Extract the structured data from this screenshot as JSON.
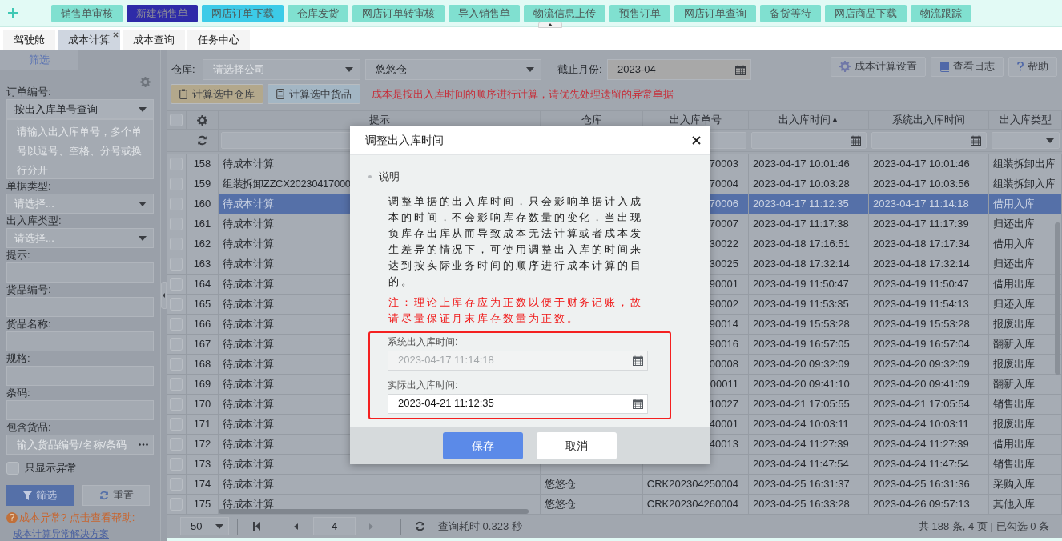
{
  "toolbar": {
    "buttons": [
      {
        "label": "销售单审核",
        "color": "#80e0d0"
      },
      {
        "label": "新建销售单",
        "color": "#2e2ba8"
      },
      {
        "label": "网店订单下载",
        "color": "#3ccbe8"
      },
      {
        "label": "仓库发货",
        "color": "#80e0d0"
      },
      {
        "label": "网店订单转审核",
        "color": "#80e0d0"
      },
      {
        "label": "导入销售单",
        "color": "#80e0d0"
      },
      {
        "label": "物流信息上传",
        "color": "#80e0d0"
      },
      {
        "label": "预售订单",
        "color": "#80e0d0"
      },
      {
        "label": "网店订单查询",
        "color": "#80e0d0"
      },
      {
        "label": "备货等待",
        "color": "#80e0d0"
      },
      {
        "label": "网店商品下载",
        "color": "#80e0d0"
      },
      {
        "label": "物流跟踪",
        "color": "#80e0d0"
      }
    ]
  },
  "tabs": [
    {
      "label": "驾驶舱",
      "selected": false,
      "closable": false
    },
    {
      "label": "成本计算",
      "selected": true,
      "closable": true
    },
    {
      "label": "成本查询",
      "selected": false,
      "closable": false
    },
    {
      "label": "任务中心",
      "selected": false,
      "closable": false
    }
  ],
  "sidebar": {
    "tab": "筛选",
    "fields": [
      {
        "label": "订单编号:",
        "kind": "select",
        "value": "按出入库单号查询"
      },
      {
        "kind": "textarea",
        "placeholder": "请输入出入库单号，多个单号以逗号、空格、分号或换行分开"
      },
      {
        "label": "单据类型:",
        "kind": "select",
        "placeholder": "请选择..."
      },
      {
        "label": "出入库类型:",
        "kind": "select",
        "placeholder": "请选择..."
      },
      {
        "label": "提示:",
        "kind": "input"
      },
      {
        "label": "货品编号:",
        "kind": "input"
      },
      {
        "label": "货品名称:",
        "kind": "input"
      },
      {
        "label": "规格:",
        "kind": "input"
      },
      {
        "label": "条码:",
        "kind": "input"
      },
      {
        "label": "包含货品:",
        "kind": "picker",
        "placeholder": "输入货品编号/名称/条码"
      }
    ],
    "only_abnormal": {
      "label": "只显示异常",
      "checked": false
    },
    "buttons": [
      {
        "label": "筛选",
        "kind": "primary"
      },
      {
        "label": "重置",
        "kind": "default"
      }
    ],
    "help_text": "成本异常? 点击查看帮助:",
    "help_link": "成本计算异常解决方案"
  },
  "filters": {
    "warehouse_label": "仓库:",
    "company_placeholder": "请选择公司",
    "warehouse_value": "悠悠仓",
    "month_label": "截止月份:",
    "month_value": "2023-04",
    "tools": [
      "成本计算设置",
      "查看日志",
      "帮助"
    ],
    "actions": [
      {
        "label": "计算选中仓库",
        "color": "#b3a88c"
      },
      {
        "label": "计算选中货品",
        "color": "#a3b6c4"
      }
    ],
    "notice": "成本是按出入库时间的顺序进行计算，请优先处理遗留的异常单据"
  },
  "table": {
    "select_all": {
      "checked": false
    },
    "columns": [
      {
        "label": "提示"
      },
      {
        "label": "仓库"
      },
      {
        "label": "出入库单号"
      },
      {
        "label": "出入库时间",
        "sort_mark": "▲"
      },
      {
        "label": "系统出入库时间"
      },
      {
        "label": "出入库类型"
      }
    ],
    "rows": [
      {
        "index": "158",
        "checked": false,
        "selected": false,
        "hint": "待成本计算",
        "doc_no": "70003",
        "time": "2023-04-17 10:01:46",
        "sys_time": "2023-04-17 10:01:46",
        "type": "组装拆卸出库"
      },
      {
        "index": "159",
        "checked": false,
        "selected": false,
        "hint": "组装拆卸ZZCX20230417000",
        "doc_no": "70004",
        "time": "2023-04-17 10:03:28",
        "sys_time": "2023-04-17 10:03:56",
        "type": "组装拆卸入库"
      },
      {
        "index": "160",
        "checked": false,
        "selected": true,
        "hint": "待成本计算",
        "doc_no": "70006",
        "time": "2023-04-17 11:12:35",
        "sys_time": "2023-04-17 11:14:18",
        "type": "借用入库"
      },
      {
        "index": "161",
        "checked": false,
        "selected": false,
        "hint": "待成本计算",
        "doc_no": "70007",
        "time": "2023-04-17 11:17:38",
        "sys_time": "2023-04-17 11:17:39",
        "type": "归还出库"
      },
      {
        "index": "162",
        "checked": false,
        "selected": false,
        "hint": "待成本计算",
        "doc_no": "30022",
        "time": "2023-04-18 17:16:51",
        "sys_time": "2023-04-18 17:17:34",
        "type": "借用入库"
      },
      {
        "index": "163",
        "checked": false,
        "selected": false,
        "hint": "待成本计算",
        "doc_no": "30025",
        "time": "2023-04-18 17:32:14",
        "sys_time": "2023-04-18 17:32:14",
        "type": "归还出库"
      },
      {
        "index": "164",
        "checked": false,
        "selected": false,
        "hint": "待成本计算",
        "doc_no": "90001",
        "time": "2023-04-19 11:50:47",
        "sys_time": "2023-04-19 11:50:47",
        "type": "借用出库"
      },
      {
        "index": "165",
        "checked": false,
        "selected": false,
        "hint": "待成本计算",
        "doc_no": "90002",
        "time": "2023-04-19 11:53:35",
        "sys_time": "2023-04-19 11:54:13",
        "type": "归还入库"
      },
      {
        "index": "166",
        "checked": false,
        "selected": false,
        "hint": "待成本计算",
        "doc_no": "90014",
        "time": "2023-04-19 15:53:28",
        "sys_time": "2023-04-19 15:53:28",
        "type": "报废出库"
      },
      {
        "index": "167",
        "checked": false,
        "selected": false,
        "hint": "待成本计算",
        "doc_no": "90016",
        "time": "2023-04-19 16:57:05",
        "sys_time": "2023-04-19 16:57:04",
        "type": "翻新入库"
      },
      {
        "index": "168",
        "checked": false,
        "selected": false,
        "hint": "待成本计算",
        "doc_no": "00008",
        "time": "2023-04-20 09:32:09",
        "sys_time": "2023-04-20 09:32:09",
        "type": "报废出库"
      },
      {
        "index": "169",
        "checked": false,
        "selected": false,
        "hint": "待成本计算",
        "doc_no": "00011",
        "time": "2023-04-20 09:41:10",
        "sys_time": "2023-04-20 09:41:09",
        "type": "翻新入库"
      },
      {
        "index": "170",
        "checked": false,
        "selected": false,
        "hint": "待成本计算",
        "doc_no": "10027",
        "time": "2023-04-21 17:05:55",
        "sys_time": "2023-04-21 17:05:54",
        "type": "销售出库"
      },
      {
        "index": "171",
        "checked": false,
        "selected": false,
        "hint": "待成本计算",
        "doc_no": "40001",
        "time": "2023-04-24 10:03:11",
        "sys_time": "2023-04-24 10:03:11",
        "type": "报废出库"
      },
      {
        "index": "172",
        "checked": false,
        "selected": false,
        "hint": "待成本计算",
        "doc_no": "40013",
        "time": "2023-04-24 11:27:39",
        "sys_time": "2023-04-24 11:27:39",
        "type": "借用出库"
      },
      {
        "index": "173",
        "checked": false,
        "selected": false,
        "hint": "待成本计算",
        "time": "2023-04-24 11:47:54",
        "sys_time": "2023-04-24 11:47:54",
        "type": "销售出库"
      },
      {
        "index": "174",
        "checked": false,
        "selected": false,
        "hint": "待成本计算",
        "warehouse": "悠悠仓",
        "doc_no": "CRK202304250004",
        "time": "2023-04-25 16:31:37",
        "sys_time": "2023-04-25 16:31:36",
        "type": "采购入库"
      },
      {
        "index": "175",
        "checked": false,
        "selected": false,
        "hint": "待成本计算",
        "warehouse": "悠悠仓",
        "doc_no": "CRK202304260004",
        "time": "2023-04-25 16:33:28",
        "sys_time": "2023-04-26 09:57:13",
        "type": "其他入库"
      }
    ]
  },
  "pagination": {
    "page_size": "50",
    "page": "4",
    "query_time": "查询耗时 0.323 秒",
    "summary": "共 188 条, 4 页 | 已勾选 0 条"
  },
  "dialog": {
    "title": "调整出入库时间",
    "section": "说明",
    "description": "调整单据的出入库时间，只会影响单据计入成本的时间，不会影响库存数量的变化，当出现负库存出库从而导致成本无法计算或者成本发生差异的情况下，可使用调整出入库的时间来达到按实际业务时间的顺序进行成本计算的目的。",
    "note": "注：理论上库存应为正数以便于财务记账，故请尽量保证月末库存数量为正数。",
    "fields": [
      {
        "label": "系统出入库时间:",
        "value": "2023-04-17 11:14:18",
        "disabled": true
      },
      {
        "label": "实际出入库时间:",
        "value": "2023-04-21 11:12:35",
        "disabled": false
      }
    ],
    "buttons": [
      {
        "label": "保存",
        "kind": "primary"
      },
      {
        "label": "取消",
        "kind": "default"
      }
    ]
  }
}
